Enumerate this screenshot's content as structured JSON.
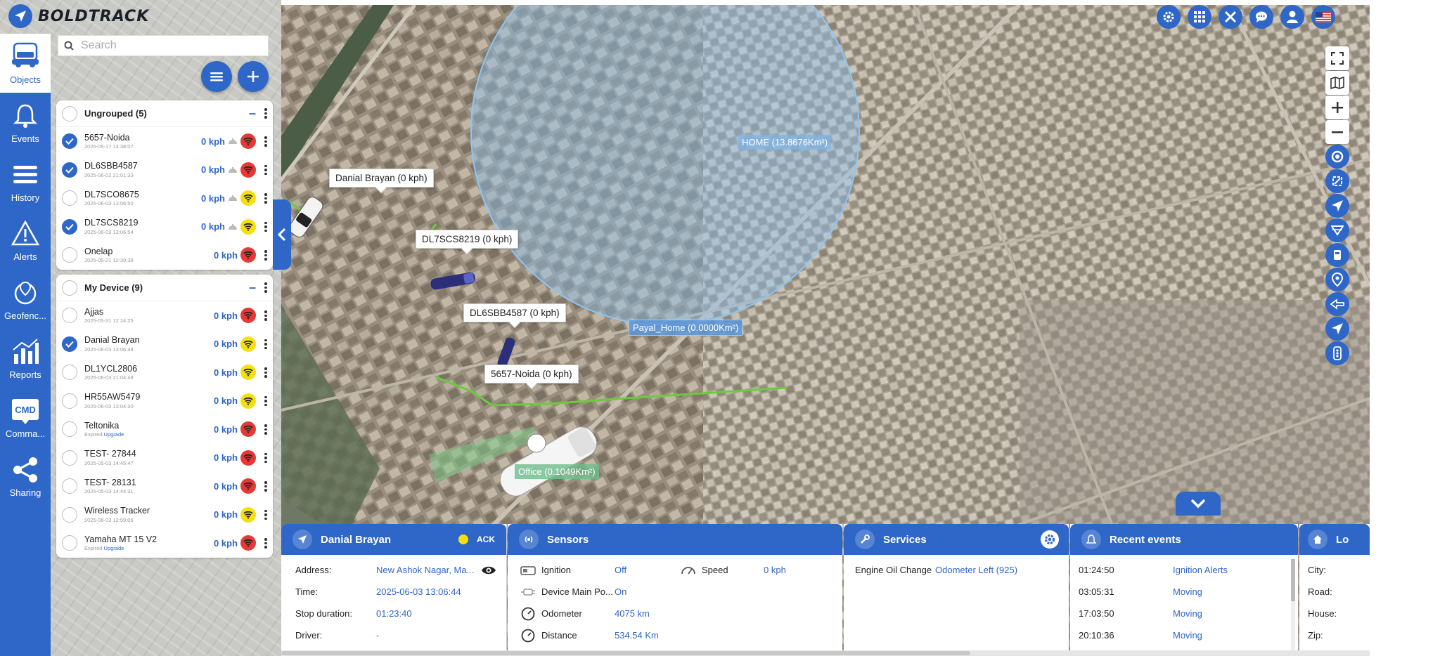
{
  "app": {
    "brand": "BOLDTRACK"
  },
  "colors": {
    "accent": "#2e67c8",
    "signal_red": "#e53935",
    "signal_yellow": "#f4e00f",
    "route_green": "#6ccb3c",
    "zone_blue": "#7fb6e8"
  },
  "nav": [
    {
      "label": "Objects",
      "icon": "car-icon",
      "active": true
    },
    {
      "label": "Events",
      "icon": "bell-icon"
    },
    {
      "label": "History",
      "icon": "list-icon"
    },
    {
      "label": "Alerts",
      "icon": "warning-icon"
    },
    {
      "label": "Geofenc...",
      "icon": "geofence-icon"
    },
    {
      "label": "Reports",
      "icon": "bar-chart-icon"
    },
    {
      "label": "Comma...",
      "icon": "cmd-icon",
      "badge": "CMD"
    },
    {
      "label": "Sharing",
      "icon": "share-icon"
    }
  ],
  "search": {
    "placeholder": "Search"
  },
  "groups": [
    {
      "title": "Ungrouped (5)",
      "devices": [
        {
          "name": "5657-Noida",
          "time": "2025-05-17 14:38:07",
          "speed": "0 kph",
          "signal": "red",
          "checked": true,
          "ignition": true
        },
        {
          "name": "DL6SBB4587",
          "time": "2025-06-02 21:01:33",
          "speed": "0 kph",
          "signal": "red",
          "checked": true,
          "ignition": true
        },
        {
          "name": "DL7SCO8675",
          "time": "2025-06-03 13:06:50",
          "speed": "0 kph",
          "signal": "yellow",
          "checked": false,
          "ignition": true
        },
        {
          "name": "DL7SCS8219",
          "time": "2025-06-03 13:06:54",
          "speed": "0 kph",
          "signal": "yellow",
          "checked": true,
          "ignition": true
        },
        {
          "name": "Onelap",
          "time": "2025-05-21 12:39:38",
          "speed": "0 kph",
          "signal": "red",
          "checked": false,
          "ignition": false
        }
      ]
    },
    {
      "title": "My Device (9)",
      "devices": [
        {
          "name": "Ajjas",
          "time": "2025-05-31 12:24:25",
          "speed": "0 kph",
          "signal": "red",
          "checked": false,
          "ignition": false
        },
        {
          "name": "Danial Brayan",
          "time": "2025-06-03 13:06:44",
          "speed": "0 kph",
          "signal": "yellow",
          "checked": true,
          "ignition": false
        },
        {
          "name": "DL1YCL2806",
          "time": "2025-06-03 21:04:48",
          "speed": "0 kph",
          "signal": "yellow",
          "checked": false,
          "ignition": false
        },
        {
          "name": "HR55AW5479",
          "time": "2025-06-03 13:04:30",
          "speed": "0 kph",
          "signal": "yellow",
          "checked": false,
          "ignition": false
        },
        {
          "name": "Teltonika",
          "time": "Expired",
          "upgrade": "Upgrade",
          "speed": "0 kph",
          "signal": "red",
          "checked": false,
          "ignition": false
        },
        {
          "name": "TEST- 27844",
          "time": "2025-05-03 14:45:47",
          "speed": "0 kph",
          "signal": "red",
          "checked": false,
          "ignition": false
        },
        {
          "name": "TEST- 28131",
          "time": "2025-05-03 14:44:31",
          "speed": "0 kph",
          "signal": "red",
          "checked": false,
          "ignition": false
        },
        {
          "name": "Wireless Tracker",
          "time": "2025-06-03 12:59:06",
          "speed": "0 kph",
          "signal": "yellow",
          "checked": false,
          "ignition": false
        },
        {
          "name": "Yamaha MT 15 V2",
          "time": "Expired",
          "upgrade": "Upgrade",
          "speed": "0 kph",
          "signal": "red",
          "checked": false,
          "ignition": false
        }
      ]
    }
  ],
  "map": {
    "vehicle_labels": [
      "Danial Brayan (0 kph)",
      "DL7SCS8219 (0 kph)",
      "DL6SBB4587 (0 kph)",
      "5657-Noida (0 kph)"
    ],
    "zones": [
      "HOME (13.8676Km²)",
      "Payal_Home (0.0000Km²)",
      "Office (0.1049Km²)"
    ]
  },
  "top_icons": [
    "settings-icon",
    "apps-grid-icon",
    "tools-icon",
    "chat-icon",
    "user-icon",
    "us-flag-icon"
  ],
  "tools": [
    "fullscreen-icon",
    "map-layers-icon",
    "zoom-in-icon",
    "zoom-out-icon",
    "target-icon",
    "fit-bounds-icon",
    "locate-icon",
    "filter-icon",
    "street-view-icon",
    "pin-icon",
    "ruler-icon",
    "navigate-icon",
    "traffic-icon"
  ],
  "detail": {
    "title": "Danial Brayan",
    "ack": "ACK",
    "rows": [
      {
        "label": "Address:",
        "value": "New Ashok Nagar, Ma..."
      },
      {
        "label": "Time:",
        "value": "2025-06-03 13:06:44"
      },
      {
        "label": "Stop duration:",
        "value": "01:23:40"
      },
      {
        "label": "Driver:",
        "value": "-"
      }
    ]
  },
  "sensors": {
    "title": "Sensors",
    "left": [
      {
        "label": "Ignition",
        "value": "Off",
        "icon": "ignition-icon"
      },
      {
        "label": "Device Main Po...",
        "value": "On",
        "icon": "power-plug-icon"
      },
      {
        "label": "Odometer",
        "value": "4075 km",
        "icon": "gauge-icon"
      },
      {
        "label": "Distance",
        "value": "534.54 Km",
        "icon": "gauge-icon"
      }
    ],
    "right": [
      {
        "label": "Speed",
        "value": "0 kph",
        "icon": "speedometer-icon"
      }
    ]
  },
  "services": {
    "title": "Services",
    "rows": [
      {
        "label": "Engine Oil Change",
        "value": "Odometer Left (925)"
      }
    ]
  },
  "events": {
    "title": "Recent events",
    "rows": [
      {
        "time": "01:24:50",
        "event": "Ignition Alerts"
      },
      {
        "time": "03:05:31",
        "event": "Moving"
      },
      {
        "time": "17:03:50",
        "event": "Moving"
      },
      {
        "time": "20:10:36",
        "event": "Moving"
      }
    ]
  },
  "location": {
    "title": "Lo",
    "rows": [
      "City:",
      "Road:",
      "House:",
      "Zip:"
    ]
  }
}
